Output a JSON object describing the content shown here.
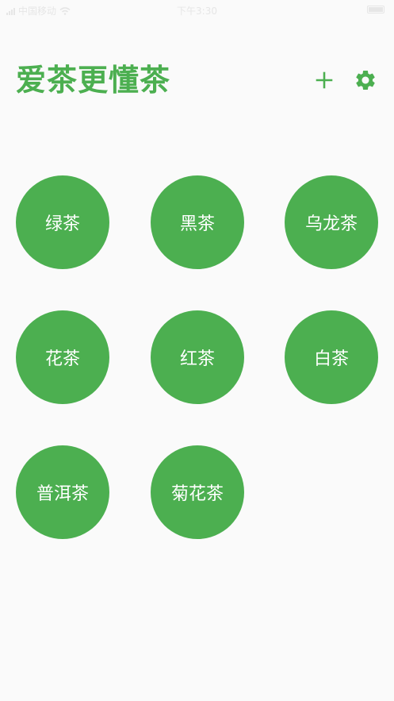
{
  "status_bar": {
    "carrier": "中国移动",
    "time": "下午3:30"
  },
  "header": {
    "title": "爱茶更懂茶",
    "add_icon": "plus-icon",
    "settings_icon": "gear-icon"
  },
  "accent_color": "#4caf50",
  "background_color": "#fafafa",
  "tea_categories": [
    {
      "label": "绿茶"
    },
    {
      "label": "黑茶"
    },
    {
      "label": "乌龙茶"
    },
    {
      "label": "花茶"
    },
    {
      "label": "红茶"
    },
    {
      "label": "白茶"
    },
    {
      "label": "普洱茶"
    },
    {
      "label": "菊花茶"
    }
  ]
}
